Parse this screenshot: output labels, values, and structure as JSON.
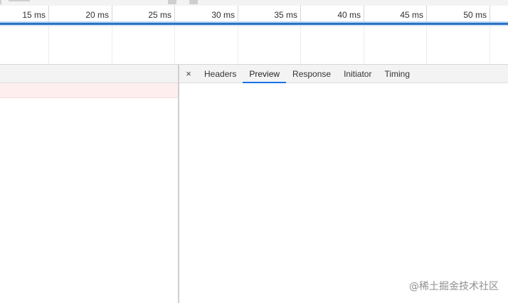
{
  "timeline": {
    "ticks": [
      "15 ms",
      "20 ms",
      "25 ms",
      "30 ms",
      "35 ms",
      "40 ms",
      "45 ms",
      "50 ms"
    ]
  },
  "details": {
    "close_glyph": "×",
    "tabs": [
      {
        "label": "Headers",
        "active": false
      },
      {
        "label": "Preview",
        "active": true
      },
      {
        "label": "Response",
        "active": false
      },
      {
        "label": "Initiator",
        "active": false
      },
      {
        "label": "Timing",
        "active": false
      }
    ]
  },
  "watermark": "@稀土掘金技术社区",
  "colors": {
    "accent": "#1a73e8",
    "selected_row": "#ffeeee",
    "overview_line": "#2b73c4"
  }
}
